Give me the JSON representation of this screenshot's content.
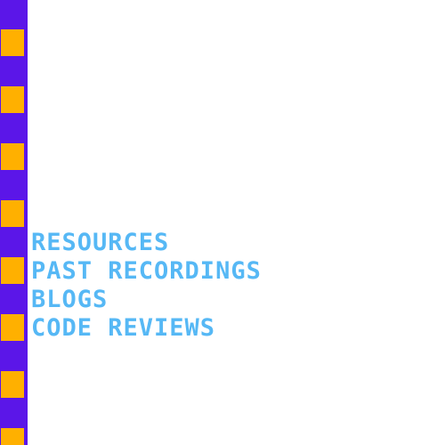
{
  "theme": {
    "stripe_color": "#5b16e8",
    "stripe_square_color": "#ffb000",
    "link_color": "#56b8f5",
    "background": "#ffffff"
  },
  "nav": {
    "items": [
      {
        "label": "RESOURCES"
      },
      {
        "label": "PAST RECORDINGS"
      },
      {
        "label": "BLOGS"
      },
      {
        "label": "CODE REVIEWS"
      }
    ]
  }
}
